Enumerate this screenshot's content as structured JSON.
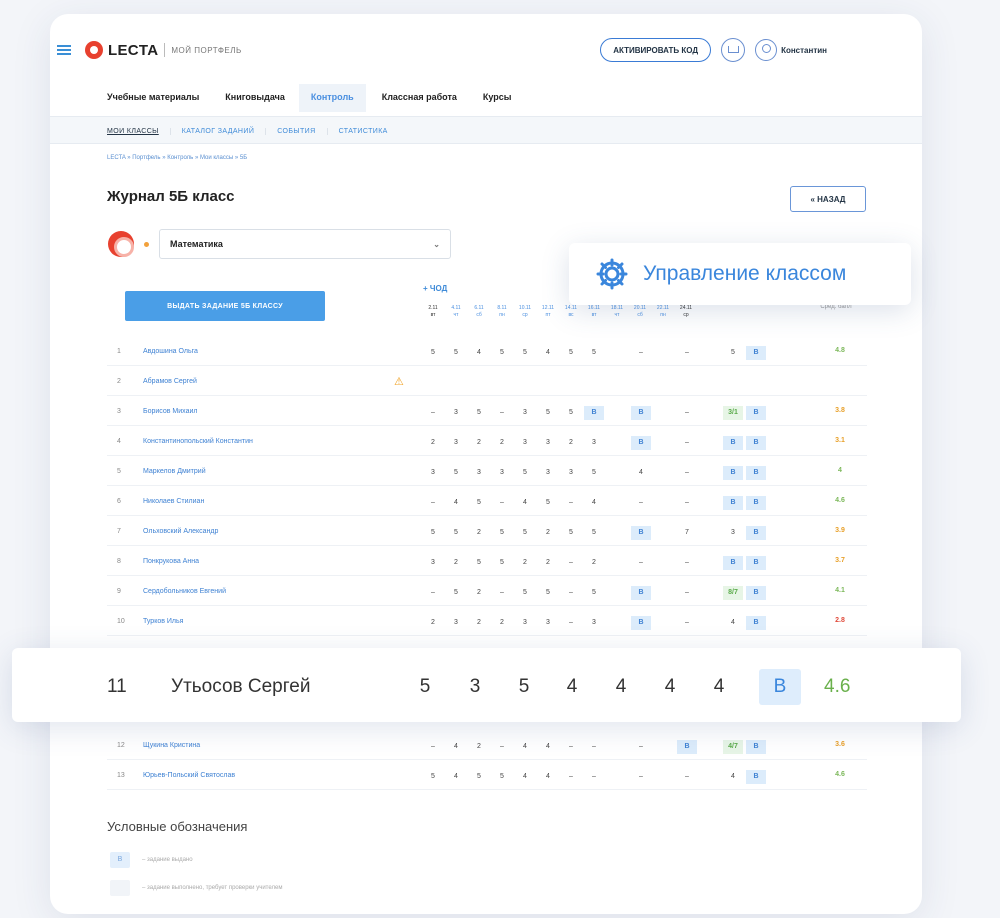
{
  "header": {
    "logo": "LECTA",
    "subtitle": "МОЙ ПОРТФЕЛЬ",
    "activate_label": "АКТИВИРОВАТЬ КОД",
    "user_name": "Константин"
  },
  "main_nav": [
    "Учебные материалы",
    "Книговыдача",
    "Контроль",
    "Классная работа",
    "Курсы"
  ],
  "main_nav_active": "Контроль",
  "sub_nav": [
    "МОИ КЛАССЫ",
    "КАТАЛОГ ЗАДАНИЙ",
    "СОБЫТИЯ",
    "СТАТИСТИКА"
  ],
  "breadcrumb": "LECTA » Портфель » Контроль » Мои классы » 5Б",
  "page_title": "Журнал 5Б класс",
  "back_label": "« НАЗАД",
  "subject": "Математика",
  "assign_label": "ВЫДАТЬ ЗАДАНИЕ 5Б КЛАССУ",
  "add_date_label": "+ ЧОД",
  "manage_label": "Управление классом",
  "avg_header": "Сред. балл",
  "dates": [
    {
      "d": "2.11",
      "w": "вт"
    },
    {
      "d": "4.11",
      "w": "чт"
    },
    {
      "d": "6.11",
      "w": "сб"
    },
    {
      "d": "8.11",
      "w": "пн"
    },
    {
      "d": "10.11",
      "w": "ср"
    },
    {
      "d": "12.11",
      "w": "пт"
    },
    {
      "d": "14.11",
      "w": "вс"
    },
    {
      "d": "16.11",
      "w": "вт"
    },
    {
      "d": "18.11",
      "w": "чт"
    },
    {
      "d": "20.11",
      "w": "сб"
    },
    {
      "d": "22.11",
      "w": "пн"
    },
    {
      "d": "24.11",
      "w": "ср"
    }
  ],
  "students": [
    {
      "n": "1",
      "name": "Авдошина Ольга",
      "cells": [
        "5",
        "5",
        "4",
        "5",
        "5",
        "4",
        "5",
        "5",
        "–",
        "–",
        "5",
        "В"
      ],
      "avg": "4.8",
      "avg_color": "#7cb85a"
    },
    {
      "n": "2",
      "name": "Абрамов Сергей",
      "cells": [
        "",
        "",
        "",
        "",
        "",
        "",
        "",
        "",
        "",
        "",
        "",
        ""
      ],
      "avg": "",
      "avg_color": "#7cb85a",
      "warn": true
    },
    {
      "n": "3",
      "name": "Борисов Михаил",
      "cells": [
        "–",
        "3",
        "5",
        "–",
        "3",
        "5",
        "5",
        "В",
        "В",
        "–",
        "3/1",
        "В"
      ],
      "avg": "3.8",
      "avg_color": "#e8a02a"
    },
    {
      "n": "4",
      "name": "Константинопольский Константин",
      "cells": [
        "2",
        "3",
        "2",
        "2",
        "3",
        "3",
        "2",
        "3",
        "В",
        "–",
        "В",
        "В"
      ],
      "avg": "3.1",
      "avg_color": "#e8a02a"
    },
    {
      "n": "5",
      "name": "Маркелов Дмитрий",
      "cells": [
        "3",
        "5",
        "3",
        "3",
        "5",
        "3",
        "3",
        "5",
        "4",
        "–",
        "В",
        "В"
      ],
      "avg": "4",
      "avg_color": "#7cb85a"
    },
    {
      "n": "6",
      "name": "Николаев Стилиан",
      "cells": [
        "–",
        "4",
        "5",
        "–",
        "4",
        "5",
        "–",
        "4",
        "–",
        "–",
        "В",
        "В"
      ],
      "avg": "4.6",
      "avg_color": "#7cb85a"
    },
    {
      "n": "7",
      "name": "Ольховский Александр",
      "cells": [
        "5",
        "5",
        "2",
        "5",
        "5",
        "2",
        "5",
        "5",
        "В",
        "7",
        "3",
        "В"
      ],
      "avg": "3.9",
      "avg_color": "#e8a02a"
    },
    {
      "n": "8",
      "name": "Понкрукова Анна",
      "cells": [
        "3",
        "2",
        "5",
        "5",
        "2",
        "2",
        "–",
        "2",
        "–",
        "–",
        "В",
        "В"
      ],
      "avg": "3.7",
      "avg_color": "#e8a02a"
    },
    {
      "n": "9",
      "name": "Сердобольников Евгений",
      "cells": [
        "–",
        "5",
        "2",
        "–",
        "5",
        "5",
        "–",
        "5",
        "В",
        "–",
        "8/7",
        "В"
      ],
      "avg": "4.1",
      "avg_color": "#7cb85a"
    },
    {
      "n": "10",
      "name": "Турков Илья",
      "cells": [
        "2",
        "3",
        "2",
        "2",
        "3",
        "3",
        "–",
        "3",
        "В",
        "–",
        "4",
        "В"
      ],
      "avg": "2.8",
      "avg_color": "#e04a3a"
    },
    {
      "n": "12",
      "name": "Щукина Кристина",
      "cells": [
        "–",
        "4",
        "2",
        "–",
        "4",
        "4",
        "–",
        "–",
        "–",
        "В",
        "4/7",
        "В"
      ],
      "avg": "3.6",
      "avg_color": "#e8a02a"
    },
    {
      "n": "13",
      "name": "Юрьев-Польский Святослав",
      "cells": [
        "5",
        "4",
        "5",
        "5",
        "4",
        "4",
        "–",
        "–",
        "–",
        "–",
        "4",
        "В"
      ],
      "avg": "4.6",
      "avg_color": "#7cb85a"
    }
  ],
  "highlight": {
    "n": "11",
    "name": "Утьосов Сергей",
    "cells": [
      "5",
      "3",
      "5",
      "4",
      "4",
      "4",
      "4"
    ],
    "badge": "В",
    "avg": "4.6"
  },
  "legend": {
    "title": "Условные обозначения",
    "items": [
      {
        "box": "В",
        "text": "– задание выдано"
      },
      {
        "box": "",
        "text": "– задание выполнено, требует проверки учителем"
      }
    ]
  }
}
